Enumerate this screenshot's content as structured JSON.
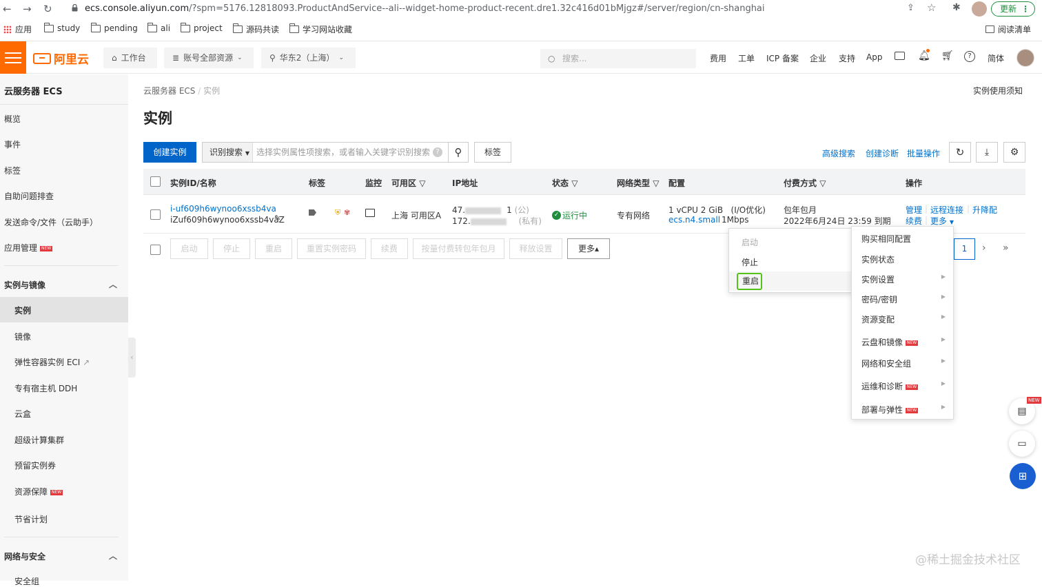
{
  "browser": {
    "url_host": "ecs.console.aliyun.com",
    "url_rest": "/?spm=5176.12818093.ProductAndService--ali--widget-home-product-recent.dre1.32c416d01bMjgz#/server/region/cn-shanghai",
    "update_label": "更新",
    "bookmarks": [
      "应用",
      "study",
      "pending",
      "ali",
      "project",
      "源码共读",
      "学习网站收藏"
    ],
    "reading_list": "阅读清单"
  },
  "topbar": {
    "logo": "阿里云",
    "workbench": "工作台",
    "resources": "账号全部资源",
    "region": "华东2（上海）",
    "search_placeholder": "搜索...",
    "links": [
      "费用",
      "工单",
      "ICP 备案",
      "企业",
      "支持",
      "App"
    ],
    "lang": "简体"
  },
  "sidebar": {
    "title": "云服务器 ECS",
    "top_items": [
      "概览",
      "事件",
      "标签",
      "自助问题排查",
      "发送命令/文件（云助手）",
      "应用管理"
    ],
    "section1": "实例与镜像",
    "section1_items": [
      "实例",
      "镜像",
      "弹性容器实例 ECI",
      "专有宿主机 DDH",
      "云盒",
      "超级计算集群",
      "预留实例券",
      "资源保障",
      "节省计划"
    ],
    "section2": "网络与安全",
    "section2_items": [
      "安全组"
    ],
    "new_badge": "NEW"
  },
  "main": {
    "breadcrumb": [
      "云服务器 ECS",
      "实例"
    ],
    "help_link": "实例使用须知",
    "title": "实例",
    "create_button": "创建实例",
    "search_type": "识别搜索",
    "search_placeholder": "选择实例属性项搜索，或者输入关键字识别搜索",
    "tag_button": "标签",
    "advanced_search": "高级搜索",
    "create_diagnosis": "创建诊断",
    "batch_ops": "批量操作",
    "columns": [
      "实例ID/名称",
      "标签",
      "监控",
      "可用区",
      "IP地址",
      "状态",
      "网络类型",
      "配置",
      "付费方式",
      "操作"
    ],
    "row": {
      "id": "i-uf609h6wynoo6xssb4va",
      "name": "iZuf609h6wynoo6xssb4vaZ",
      "zone": "上海 可用区A",
      "ip_public_prefix": "47.",
      "ip_public_tail": "1",
      "ip_public_tag": "(公)",
      "ip_private_prefix": "172.",
      "ip_private_tag": "(私有)",
      "status": "运行中",
      "network": "专有网络",
      "config_line1": "1 vCPU 2 GiB   (I/O优化)",
      "config_type": "ecs.n4.small",
      "config_bw": "1Mbps",
      "billing": "包年包月",
      "expire": "2022年6月24日 23:59 到期",
      "actions": [
        "管理",
        "远程连接",
        "升降配",
        "续费",
        "更多"
      ]
    },
    "bottom_buttons": [
      "启动",
      "停止",
      "重启",
      "重置实例密码",
      "续费",
      "按量付费转包年包月",
      "释放设置",
      "更多▴"
    ],
    "page": "1"
  },
  "menu_small": {
    "items": [
      "启动",
      "停止",
      "重启"
    ]
  },
  "menu_large": {
    "items": [
      "购买相同配置",
      "实例状态",
      "实例设置",
      "密码/密钥",
      "资源变配",
      "云盘和镜像",
      "网络和安全组",
      "运维和诊断",
      "部署与弹性"
    ]
  },
  "watermark": "@稀土掘金技术社区"
}
